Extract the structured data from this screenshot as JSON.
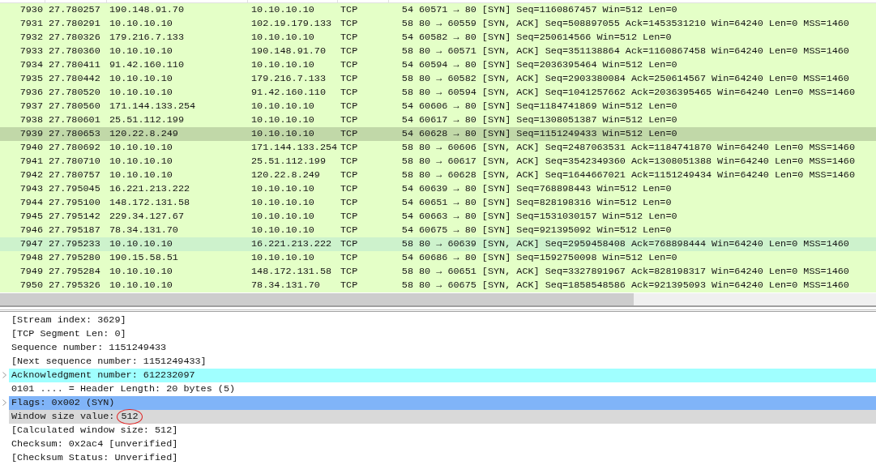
{
  "packet_list": {
    "rows": [
      {
        "no": "7930",
        "time": "27.780257",
        "source": "190.148.91.70",
        "destination": "10.10.10.10",
        "protocol": "TCP",
        "length": "54",
        "info": "60571 → 80 [SYN] Seq=1160867457 Win=512 Len=0",
        "selected": false,
        "hovered": false
      },
      {
        "no": "7931",
        "time": "27.780291",
        "source": "10.10.10.10",
        "destination": "102.19.179.133",
        "protocol": "TCP",
        "length": "58",
        "info": "80 → 60559 [SYN, ACK] Seq=508897055 Ack=1453531210 Win=64240 Len=0 MSS=1460",
        "selected": false,
        "hovered": false
      },
      {
        "no": "7932",
        "time": "27.780326",
        "source": "179.216.7.133",
        "destination": "10.10.10.10",
        "protocol": "TCP",
        "length": "54",
        "info": "60582 → 80 [SYN] Seq=250614566 Win=512 Len=0",
        "selected": false,
        "hovered": false
      },
      {
        "no": "7933",
        "time": "27.780360",
        "source": "10.10.10.10",
        "destination": "190.148.91.70",
        "protocol": "TCP",
        "length": "58",
        "info": "80 → 60571 [SYN, ACK] Seq=351138864 Ack=1160867458 Win=64240 Len=0 MSS=1460",
        "selected": false,
        "hovered": false
      },
      {
        "no": "7934",
        "time": "27.780411",
        "source": "91.42.160.110",
        "destination": "10.10.10.10",
        "protocol": "TCP",
        "length": "54",
        "info": "60594 → 80 [SYN] Seq=2036395464 Win=512 Len=0",
        "selected": false,
        "hovered": false
      },
      {
        "no": "7935",
        "time": "27.780442",
        "source": "10.10.10.10",
        "destination": "179.216.7.133",
        "protocol": "TCP",
        "length": "58",
        "info": "80 → 60582 [SYN, ACK] Seq=2903380084 Ack=250614567 Win=64240 Len=0 MSS=1460",
        "selected": false,
        "hovered": false
      },
      {
        "no": "7936",
        "time": "27.780520",
        "source": "10.10.10.10",
        "destination": "91.42.160.110",
        "protocol": "TCP",
        "length": "58",
        "info": "80 → 60594 [SYN, ACK] Seq=1041257662 Ack=2036395465 Win=64240 Len=0 MSS=1460",
        "selected": false,
        "hovered": false
      },
      {
        "no": "7937",
        "time": "27.780560",
        "source": "171.144.133.254",
        "destination": "10.10.10.10",
        "protocol": "TCP",
        "length": "54",
        "info": "60606 → 80 [SYN] Seq=1184741869 Win=512 Len=0",
        "selected": false,
        "hovered": false
      },
      {
        "no": "7938",
        "time": "27.780601",
        "source": "25.51.112.199",
        "destination": "10.10.10.10",
        "protocol": "TCP",
        "length": "54",
        "info": "60617 → 80 [SYN] Seq=1308051387 Win=512 Len=0",
        "selected": false,
        "hovered": false
      },
      {
        "no": "7939",
        "time": "27.780653",
        "source": "120.22.8.249",
        "destination": "10.10.10.10",
        "protocol": "TCP",
        "length": "54",
        "info": "60628 → 80 [SYN] Seq=1151249433 Win=512 Len=0",
        "selected": true,
        "hovered": false
      },
      {
        "no": "7940",
        "time": "27.780692",
        "source": "10.10.10.10",
        "destination": "171.144.133.254",
        "protocol": "TCP",
        "length": "58",
        "info": "80 → 60606 [SYN, ACK] Seq=2487063531 Ack=1184741870 Win=64240 Len=0 MSS=1460",
        "selected": false,
        "hovered": false
      },
      {
        "no": "7941",
        "time": "27.780710",
        "source": "10.10.10.10",
        "destination": "25.51.112.199",
        "protocol": "TCP",
        "length": "58",
        "info": "80 → 60617 [SYN, ACK] Seq=3542349360 Ack=1308051388 Win=64240 Len=0 MSS=1460",
        "selected": false,
        "hovered": false
      },
      {
        "no": "7942",
        "time": "27.780757",
        "source": "10.10.10.10",
        "destination": "120.22.8.249",
        "protocol": "TCP",
        "length": "58",
        "info": "80 → 60628 [SYN, ACK] Seq=1644667021 Ack=1151249434 Win=64240 Len=0 MSS=1460",
        "selected": false,
        "hovered": false
      },
      {
        "no": "7943",
        "time": "27.795045",
        "source": "16.221.213.222",
        "destination": "10.10.10.10",
        "protocol": "TCP",
        "length": "54",
        "info": "60639 → 80 [SYN] Seq=768898443 Win=512 Len=0",
        "selected": false,
        "hovered": false
      },
      {
        "no": "7944",
        "time": "27.795100",
        "source": "148.172.131.58",
        "destination": "10.10.10.10",
        "protocol": "TCP",
        "length": "54",
        "info": "60651 → 80 [SYN] Seq=828198316 Win=512 Len=0",
        "selected": false,
        "hovered": false
      },
      {
        "no": "7945",
        "time": "27.795142",
        "source": "229.34.127.67",
        "destination": "10.10.10.10",
        "protocol": "TCP",
        "length": "54",
        "info": "60663 → 80 [SYN] Seq=1531030157 Win=512 Len=0",
        "selected": false,
        "hovered": false
      },
      {
        "no": "7946",
        "time": "27.795187",
        "source": "78.34.131.70",
        "destination": "10.10.10.10",
        "protocol": "TCP",
        "length": "54",
        "info": "60675 → 80 [SYN] Seq=921395092 Win=512 Len=0",
        "selected": false,
        "hovered": false
      },
      {
        "no": "7947",
        "time": "27.795233",
        "source": "10.10.10.10",
        "destination": "16.221.213.222",
        "protocol": "TCP",
        "length": "58",
        "info": "80 → 60639 [SYN, ACK] Seq=2959458408 Ack=768898444 Win=64240 Len=0 MSS=1460",
        "selected": false,
        "hovered": true
      },
      {
        "no": "7948",
        "time": "27.795280",
        "source": "190.15.58.51",
        "destination": "10.10.10.10",
        "protocol": "TCP",
        "length": "54",
        "info": "60686 → 80 [SYN] Seq=1592750098 Win=512 Len=0",
        "selected": false,
        "hovered": false
      },
      {
        "no": "7949",
        "time": "27.795284",
        "source": "10.10.10.10",
        "destination": "148.172.131.58",
        "protocol": "TCP",
        "length": "58",
        "info": "80 → 60651 [SYN, ACK] Seq=3327891967 Ack=828198317 Win=64240 Len=0 MSS=1460",
        "selected": false,
        "hovered": false
      },
      {
        "no": "7950",
        "time": "27.795326",
        "source": "10.10.10.10",
        "destination": "78.34.131.70",
        "protocol": "TCP",
        "length": "58",
        "info": "80 → 60675 [SYN, ACK] Seq=1858548586 Ack=921395093 Win=64240 Len=0 MSS=1460",
        "selected": false,
        "hovered": false
      }
    ]
  },
  "packet_details": {
    "items": [
      {
        "text": "[Stream index: 3629]",
        "kind": "plain",
        "expandable": false
      },
      {
        "text": "[TCP Segment Len: 0]",
        "kind": "plain",
        "expandable": false
      },
      {
        "text": "Sequence number: 1151249433",
        "kind": "plain",
        "expandable": false
      },
      {
        "text": "[Next sequence number: 1151249433]",
        "kind": "plain",
        "expandable": false
      },
      {
        "text": "Acknowledgment number: 612232097",
        "kind": "related",
        "expandable": true
      },
      {
        "text": "0101 .... = Header Length: 20 bytes (5)",
        "kind": "plain",
        "expandable": false
      },
      {
        "text": "Flags: 0x002 (SYN)",
        "kind": "selected",
        "expandable": true
      },
      {
        "text": "Window size value:",
        "circled_value": "512",
        "kind": "hovered",
        "expandable": false
      },
      {
        "text": "[Calculated window size: 512]",
        "kind": "plain",
        "expandable": false
      },
      {
        "text": "Checksum: 0x2ac4 [unverified]",
        "kind": "plain",
        "expandable": false
      },
      {
        "text": "[Checksum Status: Unverified]",
        "kind": "plain",
        "expandable": false
      }
    ]
  }
}
